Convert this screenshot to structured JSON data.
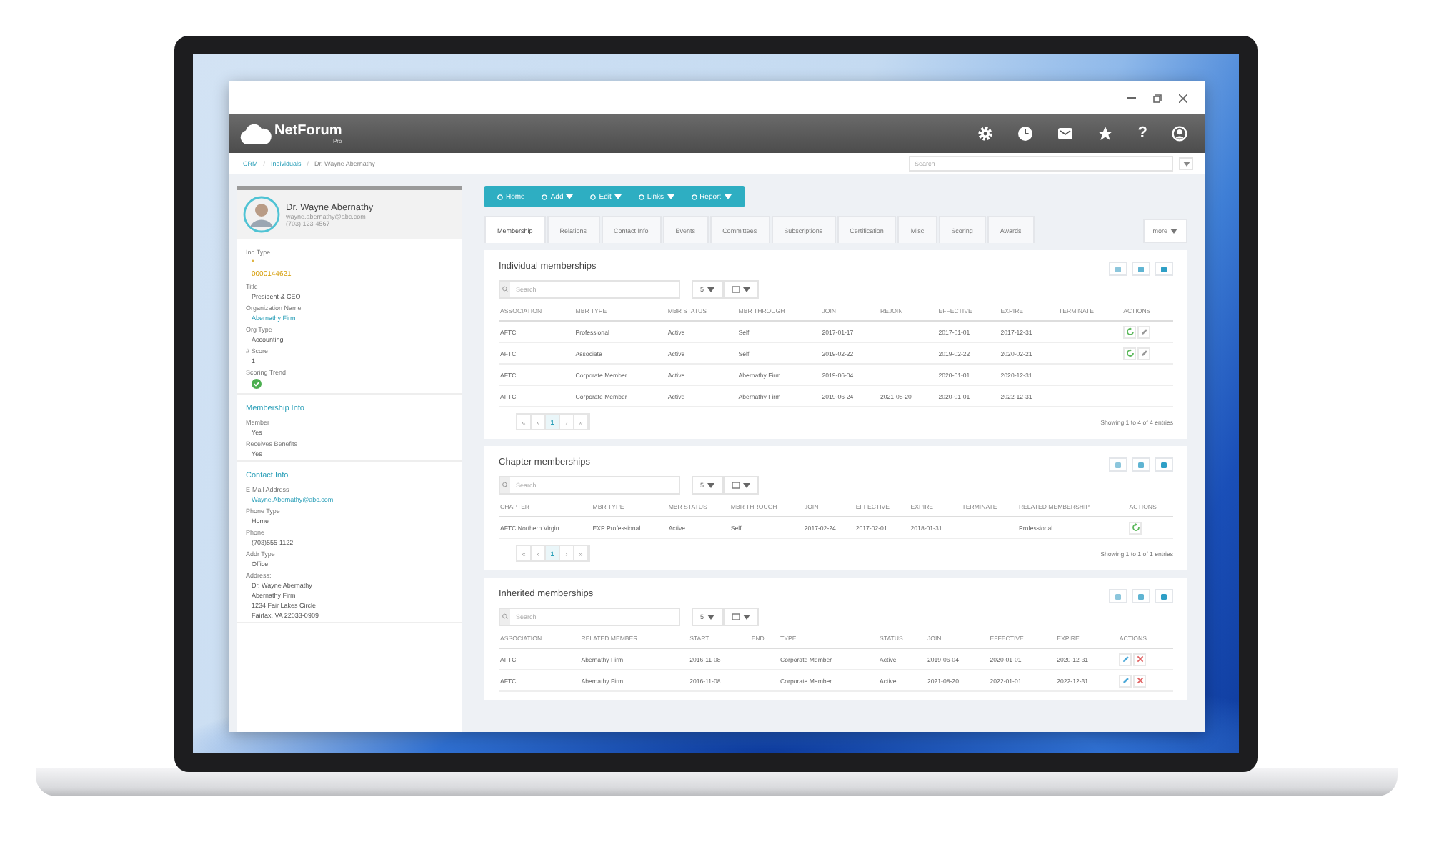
{
  "app_header": {
    "logo_text": "NetForum",
    "logo_subtext": "Pro",
    "help": "?"
  },
  "breadcrumb": [
    {
      "text": "CRM",
      "kind": "link"
    },
    {
      "text": "/",
      "kind": "separator"
    },
    {
      "text": "Individuals",
      "kind": "link"
    },
    {
      "text": "/",
      "kind": "separator"
    },
    {
      "text": "Dr. Wayne Abernathy",
      "kind": "current"
    }
  ],
  "global_search": {
    "placeholder": "Search"
  },
  "profile": {
    "name": "Dr. Wayne Abernathy",
    "email": "wayne.abernathy@abc.com",
    "phone": "(703) 123-4567"
  },
  "sections": [
    {
      "fields": [
        {
          "label": "Ind Type",
          "lines": [
            {
              "text": "*",
              "kind": "accent"
            },
            {
              "text": "0000144621",
              "kind": "accent"
            }
          ]
        },
        {
          "label": "Title",
          "lines": [
            {
              "text": "President & CEO",
              "kind": "plain"
            }
          ]
        },
        {
          "label": "Organization Name",
          "lines": [
            {
              "text": "Abernathy Firm",
              "kind": "link"
            }
          ]
        },
        {
          "label": "Org Type",
          "lines": [
            {
              "text": "Accounting",
              "kind": "plain"
            }
          ]
        },
        {
          "label": "# Score",
          "lines": [
            {
              "text": "1",
              "kind": "plain"
            }
          ]
        },
        {
          "label": "Scoring Trend",
          "kind": "trend"
        }
      ]
    },
    {
      "title": "Membership Info",
      "fields": [
        {
          "label": "Member",
          "lines": [
            {
              "text": "Yes",
              "kind": "plain"
            }
          ]
        },
        {
          "label": "Receives Benefits",
          "lines": [
            {
              "text": "Yes",
              "kind": "plain"
            }
          ]
        }
      ]
    },
    {
      "title": "Contact Info",
      "fields": [
        {
          "label": "E-Mail Address",
          "lines": [
            {
              "text": "Wayne.Abernathy@abc.com",
              "kind": "link"
            }
          ]
        },
        {
          "label": "Phone Type",
          "lines": [
            {
              "text": "Home",
              "kind": "plain"
            }
          ]
        },
        {
          "label": "Phone",
          "lines": [
            {
              "text": "(703)555-1122",
              "kind": "plain"
            }
          ]
        },
        {
          "label": "Addr Type",
          "lines": [
            {
              "text": "Office",
              "kind": "plain"
            }
          ]
        },
        {
          "label": "Address:",
          "lines": [
            {
              "text": "Dr. Wayne Abernathy",
              "kind": "plain"
            },
            {
              "text": "Abernathy Firm",
              "kind": "plain"
            },
            {
              "text": "1234 Fair Lakes Circle",
              "kind": "plain"
            },
            {
              "text": "Fairfax, VA 22033-0909",
              "kind": "plain"
            }
          ]
        }
      ]
    }
  ],
  "toolbar": [
    {
      "label": "Home",
      "menu": false
    },
    {
      "label": "Add",
      "menu": true
    },
    {
      "label": "Edit",
      "menu": true
    },
    {
      "label": "Links",
      "menu": true
    },
    {
      "label": "Report",
      "menu": true
    }
  ],
  "tabs": [
    {
      "label": "Membership",
      "selected": true
    },
    {
      "label": "Relations",
      "selected": false
    },
    {
      "label": "Contact Info",
      "selected": false
    },
    {
      "label": "Events",
      "selected": false
    },
    {
      "label": "Committees",
      "selected": false
    },
    {
      "label": "Subscriptions",
      "selected": false
    },
    {
      "label": "Certification",
      "selected": false
    },
    {
      "label": "Misc",
      "selected": false
    },
    {
      "label": "Scoring",
      "selected": false
    },
    {
      "label": "Awards",
      "selected": false
    }
  ],
  "more_tab": {
    "label": "more"
  },
  "cards": [
    {
      "title": "Individual memberships",
      "search": {
        "placeholder": "Search"
      },
      "page_size": "5",
      "columns": [
        "ASSOCIATION",
        "MBR TYPE",
        "MBR STATUS",
        "MBR THROUGH",
        "JOIN",
        "REJOIN",
        "EFFECTIVE",
        "EXPIRE",
        "TERMINATE",
        "ACTIONS"
      ],
      "rows": [
        {
          "cells": [
            "AFTC",
            "Professional",
            "Active",
            "Self",
            "2017-01-17",
            "",
            "2017-01-01",
            "2017-12-31",
            ""
          ],
          "actions": [
            {
              "kind": "renew"
            },
            {
              "kind": "edit"
            }
          ]
        },
        {
          "cells": [
            "AFTC",
            "Associate",
            "Active",
            "Self",
            "2019-02-22",
            "",
            "2019-02-22",
            "2020-02-21",
            ""
          ],
          "actions": [
            {
              "kind": "renew"
            },
            {
              "kind": "edit"
            }
          ]
        },
        {
          "cells": [
            "AFTC",
            "Corporate Member",
            "Active",
            "Abernathy Firm",
            "2019-06-04",
            "",
            "2020-01-01",
            "2020-12-31",
            ""
          ],
          "actions": []
        },
        {
          "cells": [
            "AFTC",
            "Corporate Member",
            "Active",
            "Abernathy Firm",
            "2019-06-24",
            "2021-08-20",
            "2020-01-01",
            "2022-12-31",
            ""
          ],
          "actions": []
        }
      ],
      "pages": [
        {
          "label": "«",
          "selected": false
        },
        {
          "label": "‹",
          "selected": false
        },
        {
          "label": "1",
          "selected": true
        },
        {
          "label": "›",
          "selected": false
        },
        {
          "label": "»",
          "selected": false
        }
      ],
      "summary": "Showing 1 to 4 of 4 entries"
    },
    {
      "title": "Chapter memberships",
      "search": {
        "placeholder": "Search"
      },
      "page_size": "5",
      "columns": [
        "CHAPTER",
        "MBR TYPE",
        "MBR STATUS",
        "MBR THROUGH",
        "JOIN",
        "EFFECTIVE",
        "EXPIRE",
        "TERMINATE",
        "RELATED MEMBERSHIP",
        "ACTIONS"
      ],
      "rows": [
        {
          "cells": [
            "AFTC Northern Virgin",
            "EXP Professional",
            "Active",
            "Self",
            "2017-02-24",
            "2017-02-01",
            "2018-01-31",
            "",
            "Professional"
          ],
          "actions": [
            {
              "kind": "renew"
            }
          ]
        }
      ],
      "pages": [
        {
          "label": "«",
          "selected": false
        },
        {
          "label": "‹",
          "selected": false
        },
        {
          "label": "1",
          "selected": true
        },
        {
          "label": "›",
          "selected": false
        },
        {
          "label": "»",
          "selected": false
        }
      ],
      "summary": "Showing 1 to 1 of 1 entries"
    },
    {
      "title": "Inherited memberships",
      "search": {
        "placeholder": "Search"
      },
      "page_size": "5",
      "columns": [
        "ASSOCIATION",
        "RELATED MEMBER",
        "START",
        "END",
        "TYPE",
        "STATUS",
        "JOIN",
        "EFFECTIVE",
        "EXPIRE",
        "ACTIONS"
      ],
      "rows": [
        {
          "cells": [
            "AFTC",
            "Abernathy Firm",
            "2016-11-08",
            "",
            "Corporate Member",
            "Active",
            "2019-06-04",
            "2020-01-01",
            "2020-12-31"
          ],
          "actions": [
            {
              "kind": "view"
            },
            {
              "kind": "delete"
            }
          ]
        },
        {
          "cells": [
            "AFTC",
            "Abernathy Firm",
            "2016-11-08",
            "",
            "Corporate Member",
            "Active",
            "2021-08-20",
            "2022-01-01",
            "2022-12-31"
          ],
          "actions": [
            {
              "kind": "view"
            },
            {
              "kind": "delete"
            }
          ]
        }
      ]
    }
  ]
}
